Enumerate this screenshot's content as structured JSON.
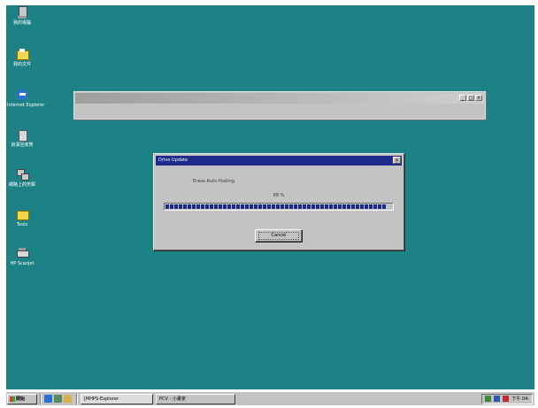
{
  "desktop": {
    "background_color": "#1d8285",
    "icons": [
      {
        "label": "我的電腦",
        "icon": "computer-icon"
      },
      {
        "label": "我的文件",
        "icon": "folder-icon"
      },
      {
        "label": "Internet Explorer",
        "icon": "internet-explorer-icon"
      },
      {
        "label": "資源回收筒",
        "icon": "recycle-bin-icon"
      },
      {
        "label": "網路上的芳鄰",
        "icon": "network-icon"
      },
      {
        "label": "Tools",
        "icon": "folder-icon"
      },
      {
        "label": "HP Scanjet",
        "icon": "scanner-icon"
      }
    ]
  },
  "background_window": {
    "title": "",
    "menu": "",
    "controls": [
      "_",
      "□",
      "×"
    ]
  },
  "dialog": {
    "title": "Drive Update",
    "status": "Erase Auto Posting",
    "percent": "98 %",
    "progress": 0.98,
    "cancel_label": "Cancel",
    "title_color": "#1d2a8a"
  },
  "taskbar": {
    "start_label": "開始",
    "quick_launch": [
      "ie-icon",
      "desktop-icon",
      "outlook-icon"
    ],
    "tasks": [
      {
        "label": "[MHPS-Explorer",
        "active": true
      },
      {
        "label": "PCV - 小畫家",
        "active": false
      }
    ],
    "tray": {
      "icons": [
        "volume-icon",
        "network-tray-icon",
        "ime-icon"
      ],
      "clock": "下午 04:"
    }
  }
}
